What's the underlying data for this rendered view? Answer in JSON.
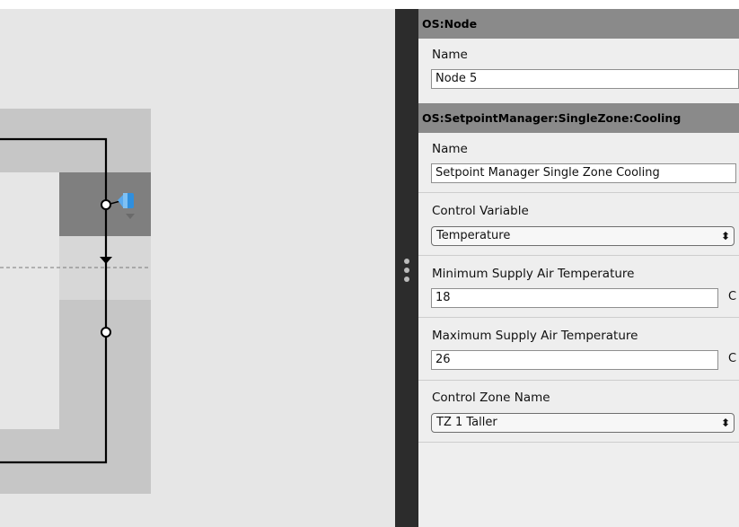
{
  "inspector": {
    "node_section": {
      "header": "OS:Node",
      "name_label": "Name",
      "name_value": "Node 5"
    },
    "spm_section": {
      "header": "OS:SetpointManager:SingleZone:Cooling",
      "name_label": "Name",
      "name_value": "Setpoint Manager Single Zone Cooling",
      "control_variable_label": "Control Variable",
      "control_variable_value": "Temperature",
      "min_temp_label": "Minimum Supply Air Temperature",
      "min_temp_value": "18",
      "min_temp_unit": "C",
      "max_temp_label": "Maximum Supply Air Temperature",
      "max_temp_value": "26",
      "max_temp_unit": "C",
      "control_zone_label": "Control Zone Name",
      "control_zone_value": "TZ 1 Taller"
    }
  },
  "icons": {
    "select_arrows": "⬍",
    "setpoint_manager": "setpoint-manager-icon"
  },
  "colors": {
    "inspector_bg": "#eeeeee",
    "section_header_bg": "#8a8a8a",
    "divider_bg": "#2c2c2c",
    "canvas_bg": "#e6e6e6",
    "loop_band": "#c6c6c6",
    "loop_band_dark": "#7f7f7f",
    "setpoint_icon_blue": "#2f8fde"
  }
}
